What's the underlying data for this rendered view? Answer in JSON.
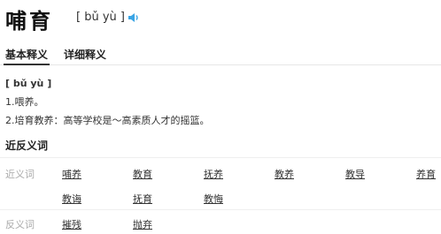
{
  "header": {
    "word": "哺育",
    "pinyin": "[ bǔ yù ]",
    "speaker_icon": "speaker-icon"
  },
  "tabs": [
    "基本释义",
    "详细释义"
  ],
  "basic": {
    "pinyin": "[ bǔ yù ]",
    "definitions": [
      "1.喂养。",
      "2.培育教养：高等学校是～高素质人才的摇篮。"
    ]
  },
  "relations": {
    "title": "近反义词",
    "synonym_label": "近义词",
    "synonyms": [
      "哺养",
      "教育",
      "抚养",
      "教养",
      "教导",
      "养育",
      "教诲",
      "抚育",
      "教悔"
    ],
    "antonym_label": "反义词",
    "antonyms": [
      "摧残",
      "抛弃"
    ]
  },
  "colors": {
    "speaker": "#3ba5e5",
    "muted_label": "#aaaaaa",
    "tab_underline": "#333333"
  }
}
